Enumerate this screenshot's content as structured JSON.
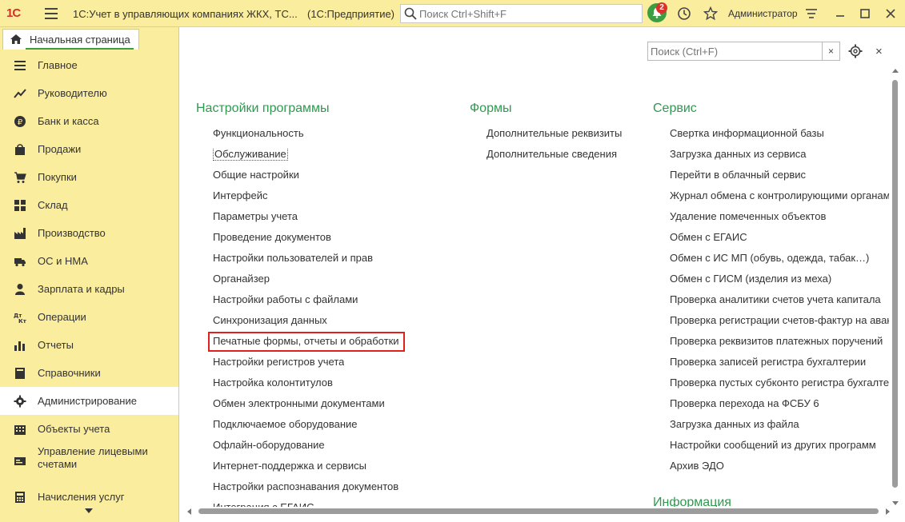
{
  "titlebar": {
    "logo": "1С",
    "title": "1С:Учет в управляющих компаниях ЖКХ, ТС...",
    "suffix": "(1С:Предприятие)",
    "search_placeholder": "Поиск Ctrl+Shift+F",
    "notifications_count": "2",
    "user": "Администратор"
  },
  "home_tab": {
    "label": "Начальная страница"
  },
  "sidebar": {
    "items": [
      {
        "label": "Главное",
        "icon": "menu-lines-icon"
      },
      {
        "label": "Руководителю",
        "icon": "trend-icon"
      },
      {
        "label": "Банк и касса",
        "icon": "ruble-coin-icon"
      },
      {
        "label": "Продажи",
        "icon": "shopping-bag-icon"
      },
      {
        "label": "Покупки",
        "icon": "shopping-cart-icon"
      },
      {
        "label": "Склад",
        "icon": "warehouse-icon"
      },
      {
        "label": "Производство",
        "icon": "factory-icon"
      },
      {
        "label": "ОС и НМА",
        "icon": "truck-icon"
      },
      {
        "label": "Зарплата и кадры",
        "icon": "person-icon"
      },
      {
        "label": "Операции",
        "icon": "debit-credit-icon"
      },
      {
        "label": "Отчеты",
        "icon": "bar-chart-icon"
      },
      {
        "label": "Справочники",
        "icon": "book-icon"
      },
      {
        "label": "Администрирование",
        "icon": "gear-icon"
      },
      {
        "label": "Объекты учета",
        "icon": "building-icon"
      },
      {
        "label": "Управление лицевыми счетами",
        "icon": "account-card-icon"
      },
      {
        "label": "Начисления услуг",
        "icon": "calculator-icon"
      }
    ],
    "active_index": 12
  },
  "panel": {
    "search_placeholder": "Поиск (Ctrl+F)",
    "clear": "×",
    "close": "×",
    "columns": [
      {
        "title": "Настройки программы",
        "links": [
          "Функциональность",
          "Обслуживание",
          "Общие настройки",
          "Интерфейс",
          "Параметры учета",
          "Проведение документов",
          "Настройки пользователей и прав",
          "Органайзер",
          "Настройки работы с файлами",
          "Синхронизация данных",
          "Печатные формы, отчеты и обработки",
          "Настройки регистров учета",
          "Настройка колонтитулов",
          "Обмен электронными документами",
          "Подключаемое оборудование",
          "Офлайн-оборудование",
          "Интернет-поддержка и сервисы",
          "Настройки распознавания документов",
          "Интеграция с ЕГАИС"
        ]
      },
      {
        "title": "Формы",
        "links": [
          "Дополнительные реквизиты",
          "Дополнительные сведения"
        ]
      },
      {
        "title": "Сервис",
        "links": [
          "Свертка информационной базы",
          "Загрузка данных из сервиса",
          "Перейти в облачный сервис",
          "Журнал обмена с контролирующими органами",
          "Удаление помеченных объектов",
          "Обмен с ЕГАИС",
          "Обмен с ИС МП (обувь, одежда, табак…)",
          "Обмен с ГИСМ (изделия из меха)",
          "Проверка аналитики счетов учета капитала",
          "Проверка регистрации счетов-фактур на аванс",
          "Проверка реквизитов платежных поручений",
          "Проверка записей регистра бухгалтерии",
          "Проверка пустых субконто регистра бухгалтерии",
          "Проверка перехода на ФСБУ 6",
          "Загрузка данных из файла",
          "Настройки сообщений из других программ",
          "Архив ЭДО"
        ]
      }
    ],
    "info_title": "Информация"
  }
}
